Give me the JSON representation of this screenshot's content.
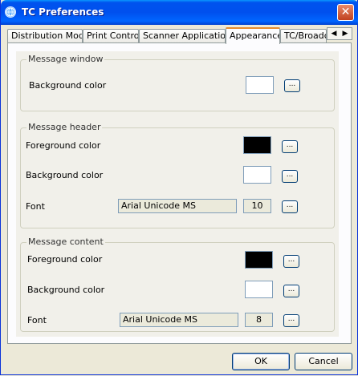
{
  "window": {
    "title": "TC Preferences",
    "close_symbol": "✕"
  },
  "tabs": [
    {
      "label": "Distribution Mode"
    },
    {
      "label": "Print Control"
    },
    {
      "label": "Scanner Application"
    },
    {
      "label": "Appearance",
      "active": true
    },
    {
      "label": "TC/Broadcast"
    }
  ],
  "tab_scroll": {
    "left": "◀",
    "right": "▶"
  },
  "browse_label": "...",
  "message_window": {
    "legend": "Message window",
    "background_label": "Background color",
    "background_color": "#ffffff"
  },
  "message_header": {
    "legend": "Message header",
    "foreground_label": "Foreground color",
    "foreground_color": "#000000",
    "background_label": "Background color",
    "background_color": "#ffffff",
    "font_label": "Font",
    "font_name": "Arial Unicode MS",
    "font_size": "10"
  },
  "message_content": {
    "legend": "Message content",
    "foreground_label": "Foreground color",
    "foreground_color": "#000000",
    "background_label": "Background color",
    "background_color": "#ffffff",
    "font_label": "Font",
    "font_name": "Arial Unicode MS",
    "font_size": "8"
  },
  "buttons": {
    "ok": "OK",
    "cancel": "Cancel"
  }
}
